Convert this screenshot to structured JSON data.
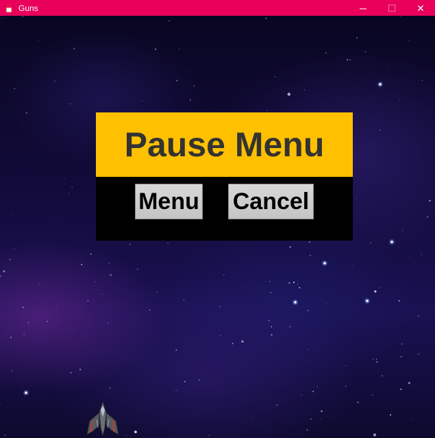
{
  "window": {
    "title": "Guns",
    "minimize_glyph": "─",
    "maximize_glyph": "☐",
    "close_glyph": "✕",
    "titlebar_color": "#e8005a"
  },
  "pause_menu": {
    "title": "Pause Menu",
    "header_color": "#ffc000",
    "menu_button_label": "Menu",
    "cancel_button_label": "Cancel"
  },
  "icons": {
    "app": "java-cup-icon",
    "player": "spaceship-icon"
  }
}
